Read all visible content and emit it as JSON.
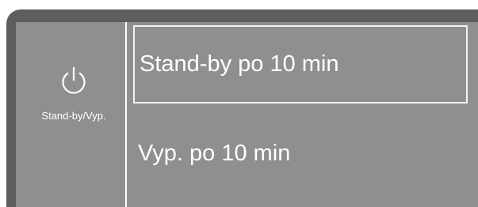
{
  "sidebar": {
    "icon": "power-icon",
    "label": "Stand-by/Vyp."
  },
  "options": [
    {
      "label": "Stand-by po 10 min",
      "selected": true
    },
    {
      "label": "Vyp. po 10 min",
      "selected": false
    }
  ],
  "colors": {
    "frame": "#5e5e5e",
    "panel": "#8f8f8f",
    "text": "#ffffff",
    "highlight_border": "#f2f2f2"
  }
}
